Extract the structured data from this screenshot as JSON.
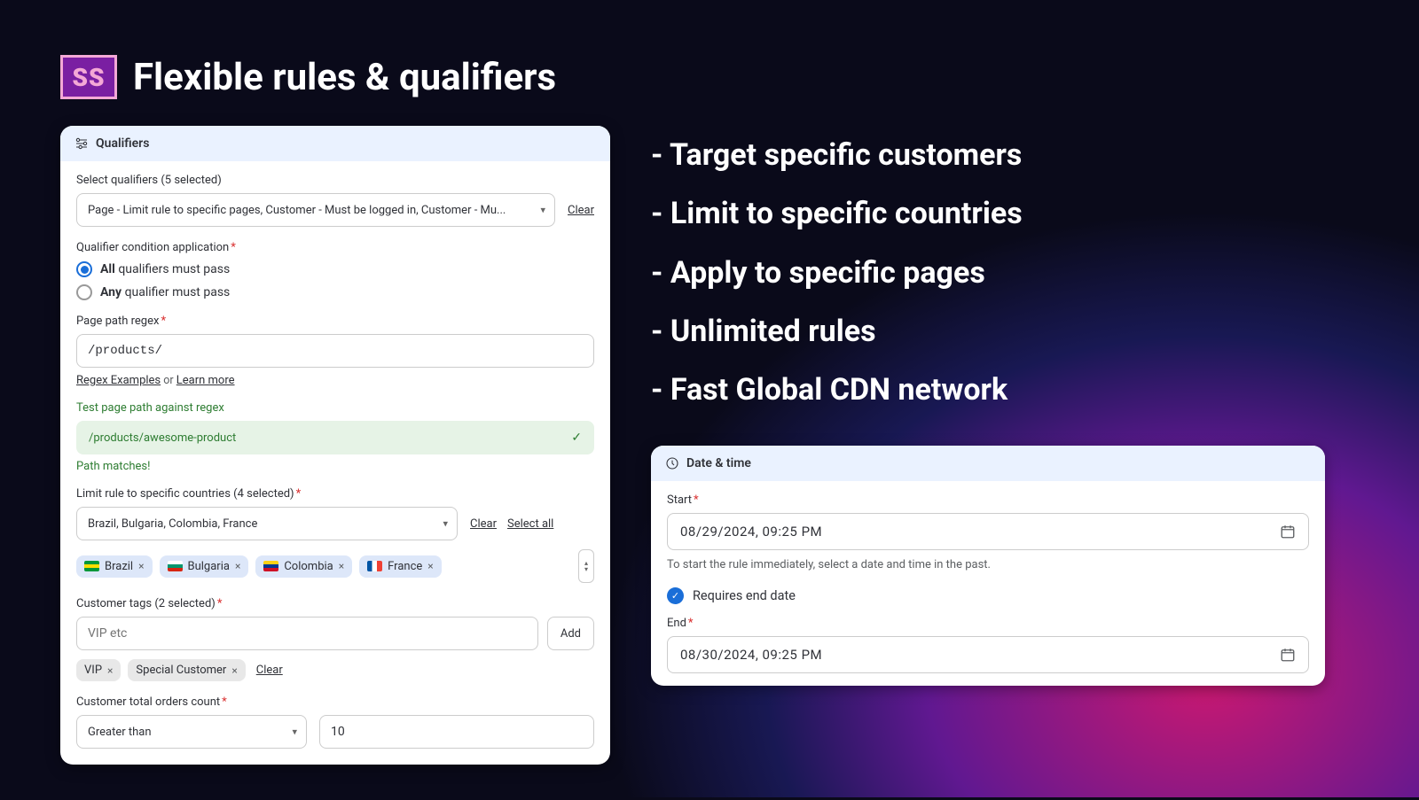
{
  "logo": "SS",
  "title": "Flexible rules & qualifiers",
  "qualifiers": {
    "header": "Qualifiers",
    "select_label": "Select qualifiers (5 selected)",
    "select_summary": "Page - Limit rule to specific pages, Customer - Must be logged in, Customer - Mu...",
    "clear": "Clear",
    "condition_label": "Qualifier condition application",
    "radio_all_b": "All",
    "radio_all_t": "qualifiers must pass",
    "radio_any_b": "Any",
    "radio_any_t": "qualifier must pass",
    "page_path_label": "Page path regex",
    "page_path_value": "/products/",
    "regex_examples": "Regex Examples",
    "or": "or",
    "learn_more": "Learn more",
    "test_label": "Test page path against regex",
    "test_value": "/products/awesome-product",
    "test_ok": "Path matches!",
    "countries_label": "Limit rule to specific countries (4 selected)",
    "countries_summary": "Brazil, Bulgaria, Colombia, France",
    "select_all": "Select all",
    "countries": [
      {
        "name": "Brazil",
        "colors": [
          "#009739",
          "#fedd00",
          "#009739"
        ]
      },
      {
        "name": "Bulgaria",
        "colors": [
          "#ffffff",
          "#00966e",
          "#d62612"
        ]
      },
      {
        "name": "Colombia",
        "colors": [
          "#fcd116",
          "#003893",
          "#ce1126"
        ]
      },
      {
        "name": "France",
        "colors": [
          "#0055a4",
          "#ffffff",
          "#ef4135"
        ],
        "v": true
      }
    ],
    "tags_label": "Customer tags (2 selected)",
    "tags_placeholder": "VIP etc",
    "add": "Add",
    "tags": [
      "VIP",
      "Special Customer"
    ],
    "orders_label": "Customer total orders count",
    "orders_op": "Greater than",
    "orders_val": "10"
  },
  "bullets": [
    "- Target specific customers",
    "- Limit to specific countries",
    "- Apply to specific pages",
    "- Unlimited rules",
    "- Fast Global CDN network"
  ],
  "datetime": {
    "header": "Date & time",
    "start_label": "Start",
    "start_value": "08/29/2024, 09:25 PM",
    "start_hint": "To start the rule immediately, select a date and time in the past.",
    "req_end": "Requires end date",
    "end_label": "End",
    "end_value": "08/30/2024, 09:25 PM"
  }
}
